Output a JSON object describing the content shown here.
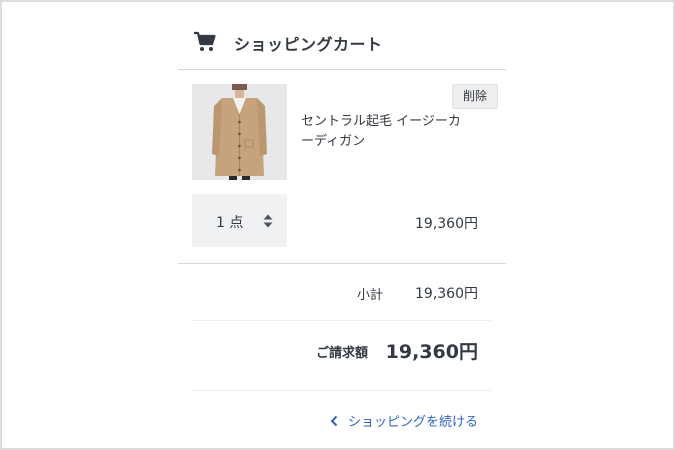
{
  "header": {
    "title": "ショッピングカート",
    "icon": "shopping-cart-icon"
  },
  "item": {
    "name": "セントラル起毛 イージーカーディガン",
    "delete_label": "削除",
    "quantity_label": "1 点",
    "price": "19,360円",
    "image": "beige-cardigan-product-photo"
  },
  "summary": {
    "subtotal_label": "小計",
    "subtotal_value": "19,360円",
    "total_label": "ご請求額",
    "total_value": "19,360円"
  },
  "continue_label": "ショッピングを続ける",
  "colors": {
    "text": "#333a44",
    "link": "#2b62c9",
    "divider": "#d8d8d8",
    "qty_bg": "#f0f1f2"
  }
}
